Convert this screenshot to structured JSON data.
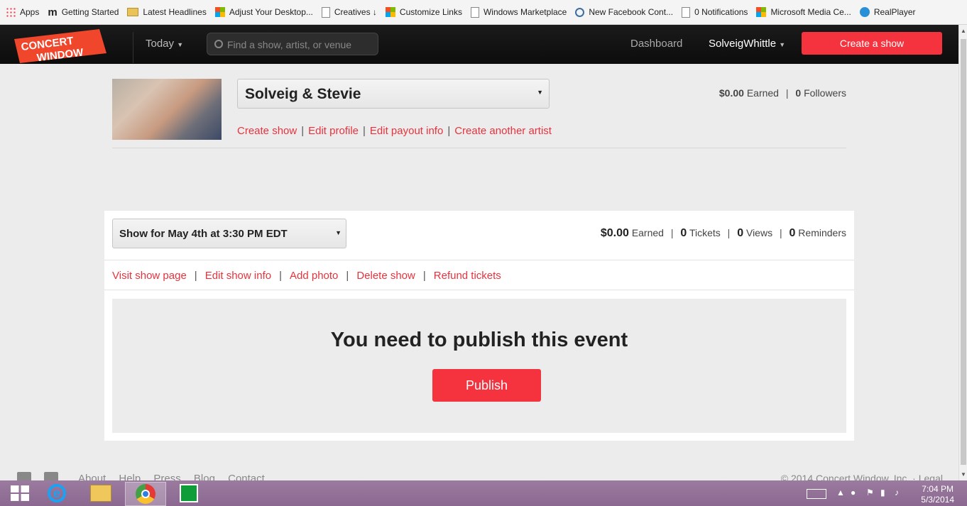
{
  "bookmarks": [
    {
      "label": "Apps",
      "icon": "apps-icon"
    },
    {
      "label": "Getting Started",
      "icon": "m-icon"
    },
    {
      "label": "Latest Headlines",
      "icon": "folder-icon"
    },
    {
      "label": "Adjust Your Desktop...",
      "icon": "windows-icon"
    },
    {
      "label": "Creatives ↓",
      "icon": "page-icon"
    },
    {
      "label": "Customize Links",
      "icon": "windows-icon"
    },
    {
      "label": "Windows Marketplace",
      "icon": "page-icon"
    },
    {
      "label": "New Facebook Cont...",
      "icon": "search-icon"
    },
    {
      "label": "0 Notifications",
      "icon": "page-icon"
    },
    {
      "label": "Microsoft Media Ce...",
      "icon": "windows-icon"
    },
    {
      "label": "RealPlayer",
      "icon": "realplayer-icon"
    }
  ],
  "nav": {
    "logo_line1": "CONCERT",
    "logo_line2": "WINDOW",
    "today_label": "Today",
    "search_placeholder": "Find a show, artist, or venue",
    "dashboard_label": "Dashboard",
    "username": "SolveigWhittle",
    "create_show_label": "Create a show"
  },
  "artist": {
    "selected_name": "Solveig & Stevie",
    "earned": "$0.00",
    "earned_label": "Earned",
    "followers": "0",
    "followers_label": "Followers",
    "links": [
      "Create show",
      "Edit profile",
      "Edit payout info",
      "Create another artist"
    ]
  },
  "show": {
    "selected_show": "Show for May 4th at 3:30 PM EDT",
    "earned": "$0.00",
    "earned_label": "Earned",
    "tickets": "0",
    "tickets_label": "Tickets",
    "views": "0",
    "views_label": "Views",
    "reminders": "0",
    "reminders_label": "Reminders",
    "links": [
      "Visit show page",
      "Edit show info",
      "Add photo",
      "Delete show",
      "Refund tickets"
    ],
    "publish_message": "You need to publish this event",
    "publish_label": "Publish"
  },
  "footer": {
    "links": [
      "About",
      "Help",
      "Press",
      "Blog",
      "Contact"
    ],
    "copyright": "© 2014 Concert Window, Inc. · Legal"
  },
  "taskbar": {
    "time": "7:04 PM",
    "date": "5/3/2014"
  },
  "colors": {
    "accent": "#f5333f",
    "link": "#e8323d",
    "nav_bg": "#111111",
    "taskbar": "#946f99"
  }
}
